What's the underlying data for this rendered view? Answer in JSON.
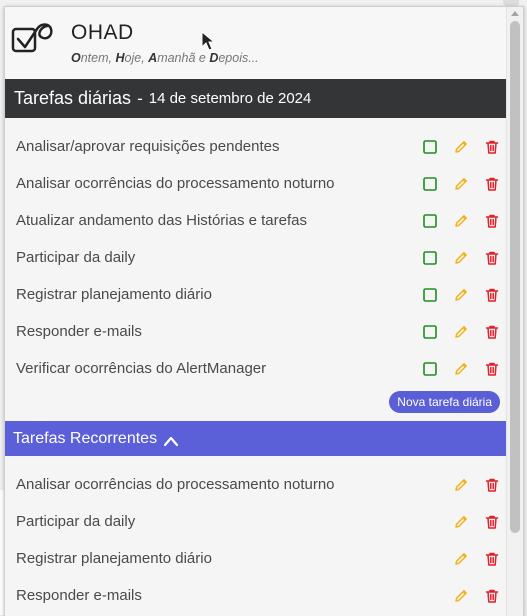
{
  "app": {
    "title": "OHAD",
    "tagline": [
      {
        "initial": "O",
        "rest": "ntem, "
      },
      {
        "initial": "H",
        "rest": "oje, "
      },
      {
        "initial": "A",
        "rest": "manhã e "
      },
      {
        "initial": "D",
        "rest": "epois..."
      }
    ]
  },
  "daily": {
    "title": "Tarefas diárias",
    "separator": "-",
    "date": "14 de setembro de 2024",
    "tasks": [
      "Analisar/aprovar requisições pendentes",
      "Analisar ocorrências do processamento noturno",
      "Atualizar andamento das Histórias e tarefas",
      "Participar da daily",
      "Registrar planejamento diário",
      "Responder e-mails",
      "Verificar ocorrências do AlertManager"
    ],
    "new_button": "Nova tarefa diária"
  },
  "recurring": {
    "title": "Tarefas Recorrentes",
    "tasks": [
      "Analisar ocorrências do processamento noturno",
      "Participar da daily",
      "Registrar planejamento diário",
      "Responder e-mails"
    ]
  },
  "icons": {
    "complete": "checkbox-icon",
    "edit": "pencil-icon",
    "delete": "trash-icon"
  },
  "colors": {
    "complete": "#1e8e1e",
    "edit": "#f2b21c",
    "delete": "#e0202a",
    "header_dark": "#333536",
    "accent": "#5b5fd8"
  }
}
